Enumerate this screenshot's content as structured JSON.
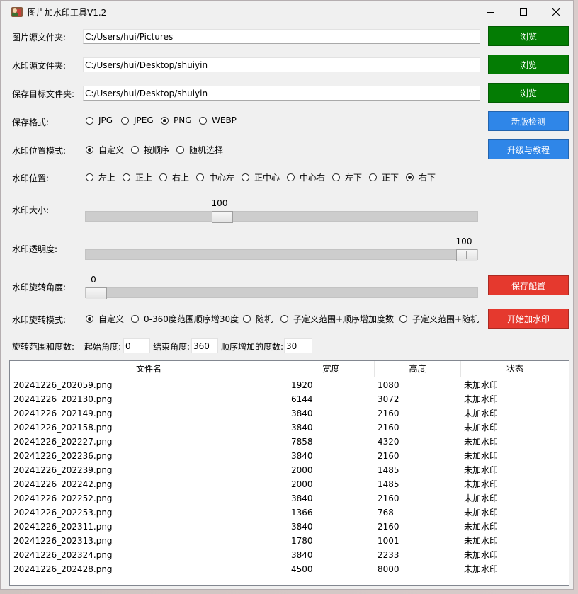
{
  "window": {
    "title": "图片加水印工具V1.2",
    "icon": "app-photo-icon"
  },
  "fields": {
    "source_label": "图片源文件夹:",
    "source_value": "C:/Users/hui/Pictures",
    "watermark_label": "水印源文件夹:",
    "watermark_value": "C:/Users/hui/Desktop/shuiyin",
    "target_label": "保存目标文件夹:",
    "target_value": "C:/Users/hui/Desktop/shuiyin"
  },
  "buttons": {
    "browse_source": "浏览",
    "browse_watermark": "浏览",
    "browse_target": "浏览",
    "check_update": "新版检测",
    "upgrade_tutorial": "升级与教程",
    "save_config": "保存配置",
    "start": "开始加水印"
  },
  "save_format": {
    "label": "保存格式:",
    "options": [
      "JPG",
      "JPEG",
      "PNG",
      "WEBP"
    ],
    "selected": "PNG"
  },
  "position_mode": {
    "label": "水印位置模式:",
    "options": [
      "自定义",
      "按顺序",
      "随机选择"
    ],
    "selected": "自定义"
  },
  "position": {
    "label": "水印位置:",
    "options": [
      "左上",
      "正上",
      "右上",
      "中心左",
      "正中心",
      "中心右",
      "左下",
      "正下",
      "右下"
    ],
    "selected": "右下"
  },
  "size": {
    "label": "水印大小:",
    "value": "100",
    "fraction": 0.34
  },
  "opacity": {
    "label": "水印透明度:",
    "value": "100",
    "fraction": 1.0
  },
  "rotation": {
    "label": "水印旋转角度:",
    "value": "0",
    "fraction": 0.0
  },
  "rotation_mode": {
    "label": "水印旋转模式:",
    "options": [
      "自定义",
      "0-360度范围顺序增30度",
      "随机",
      "子定义范围+顺序增加度数",
      "子定义范围+随机"
    ],
    "selected": "自定义"
  },
  "range": {
    "label": "旋转范围和度数:",
    "start_label": "起始角度:",
    "start_value": "0",
    "end_label": "结束角度:",
    "end_value": "360",
    "step_label": "顺序增加的度数:",
    "step_value": "30"
  },
  "table": {
    "columns": [
      "文件名",
      "宽度",
      "高度",
      "状态"
    ],
    "rows": [
      [
        "20241226_202059.png",
        "1920",
        "1080",
        "未加水印"
      ],
      [
        "20241226_202130.png",
        "6144",
        "3072",
        "未加水印"
      ],
      [
        "20241226_202149.png",
        "3840",
        "2160",
        "未加水印"
      ],
      [
        "20241226_202158.png",
        "3840",
        "2160",
        "未加水印"
      ],
      [
        "20241226_202227.png",
        "7858",
        "4320",
        "未加水印"
      ],
      [
        "20241226_202236.png",
        "3840",
        "2160",
        "未加水印"
      ],
      [
        "20241226_202239.png",
        "2000",
        "1485",
        "未加水印"
      ],
      [
        "20241226_202242.png",
        "2000",
        "1485",
        "未加水印"
      ],
      [
        "20241226_202252.png",
        "3840",
        "2160",
        "未加水印"
      ],
      [
        "20241226_202253.png",
        "1366",
        "768",
        "未加水印"
      ],
      [
        "20241226_202311.png",
        "3840",
        "2160",
        "未加水印"
      ],
      [
        "20241226_202313.png",
        "1780",
        "1001",
        "未加水印"
      ],
      [
        "20241226_202324.png",
        "3840",
        "2233",
        "未加水印"
      ],
      [
        "20241226_202428.png",
        "4500",
        "8000",
        "未加水印"
      ]
    ]
  },
  "colors": {
    "browse_green": "#047c04",
    "accent_blue": "#2f86e8",
    "action_red": "#e5392e"
  }
}
